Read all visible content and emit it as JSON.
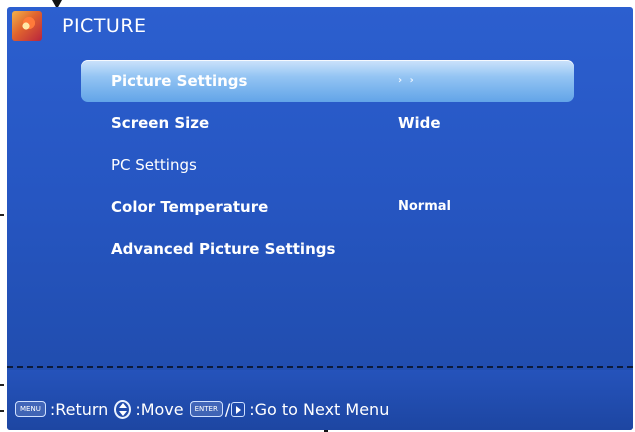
{
  "header": {
    "title": "PICTURE",
    "icon": "picture-category-icon"
  },
  "menu": {
    "items": [
      {
        "label": "Picture Settings",
        "value": "› ›",
        "selected": true
      },
      {
        "label": "Screen Size",
        "value": "Wide"
      },
      {
        "label": "PC Settings",
        "value": ""
      },
      {
        "label": "Color Temperature",
        "value": "Normal"
      },
      {
        "label": "Advanced Picture Settings",
        "value": ""
      }
    ]
  },
  "help": {
    "menu_key": "MENU",
    "return_text": ":Return",
    "move_text": ":Move",
    "enter_key": "ENTER",
    "slash": "/",
    "next_text": ":Go to Next Menu"
  },
  "colors": {
    "background": "#2656c2",
    "highlight": "#93c4f3",
    "text": "#ffffff"
  }
}
